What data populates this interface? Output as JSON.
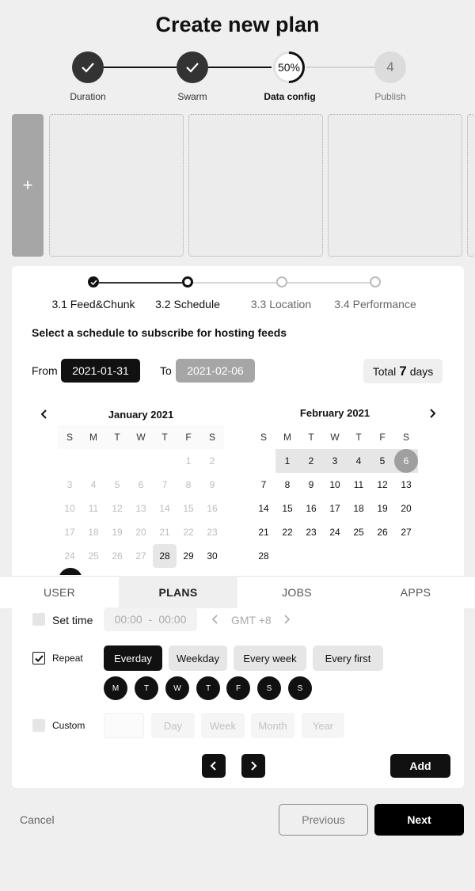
{
  "page": {
    "title": "Create new plan"
  },
  "main_steps": [
    {
      "label": "Duration",
      "state": "done"
    },
    {
      "label": "Swarm",
      "state": "done"
    },
    {
      "label": "Data config",
      "state": "in-progress",
      "progress_text": "50%",
      "progress": 0.5
    },
    {
      "label": "Publish",
      "state": "pending",
      "number": "4"
    }
  ],
  "media_strip": {
    "add_label": "+"
  },
  "sub_steps": [
    {
      "label": "3.1 Feed&Chunk",
      "state": "done"
    },
    {
      "label": "3.2 Schedule",
      "state": "current"
    },
    {
      "label": "3.3 Location",
      "state": "todo"
    },
    {
      "label": "3.4 Performance",
      "state": "todo"
    }
  ],
  "schedule": {
    "title": "Select a schedule to subscribe for hosting feeds",
    "from_label": "From",
    "from_value": "2021-01-31",
    "to_label": "To",
    "to_value": "2021-02-06",
    "total_label": "Total",
    "total_value": "7",
    "total_unit": "days"
  },
  "calendar": {
    "weekdays": [
      "S",
      "M",
      "T",
      "W",
      "T",
      "F",
      "S"
    ],
    "january": {
      "title": "January 2021",
      "rows": [
        [
          "",
          "",
          "",
          "",
          "",
          "1",
          "2"
        ],
        [
          "3",
          "4",
          "5",
          "6",
          "7",
          "8",
          "9"
        ],
        [
          "10",
          "11",
          "12",
          "13",
          "14",
          "15",
          "16"
        ],
        [
          "17",
          "18",
          "19",
          "20",
          "21",
          "22",
          "23"
        ],
        [
          "24",
          "25",
          "26",
          "27",
          "28",
          "29",
          "30"
        ]
      ]
    },
    "february": {
      "title": "February 2021",
      "rows": [
        [
          "",
          "1",
          "2",
          "3",
          "4",
          "5",
          "6"
        ],
        [
          "7",
          "8",
          "9",
          "10",
          "11",
          "12",
          "13"
        ],
        [
          "14",
          "15",
          "16",
          "17",
          "18",
          "19",
          "20"
        ],
        [
          "21",
          "22",
          "23",
          "24",
          "25",
          "26",
          "27"
        ],
        [
          "28",
          "",
          "",
          "",
          "",
          "",
          ""
        ]
      ]
    }
  },
  "tabs": [
    {
      "label": "USER",
      "active": false
    },
    {
      "label": "PLANS",
      "active": true
    },
    {
      "label": "JOBS",
      "active": false
    },
    {
      "label": "APPS",
      "active": false
    }
  ],
  "options": {
    "set_time": {
      "label": "Set time",
      "start": "00:00",
      "separator": "-",
      "end": "00:00",
      "timezone": "GMT +8",
      "checked": false
    },
    "repeat": {
      "label": "Repeat",
      "checked": true,
      "choices": [
        "Everday",
        "Weekday",
        "Every week",
        "Every first"
      ],
      "selected": "Everday",
      "days": [
        "M",
        "T",
        "W",
        "T",
        "F",
        "S",
        "S"
      ]
    },
    "custom": {
      "label": "Custom",
      "checked": false,
      "units": [
        "Day",
        "Week",
        "Month",
        "Year"
      ]
    },
    "add_label": "Add"
  },
  "footer": {
    "cancel_label": "Cancel",
    "previous_label": "Previous",
    "next_label": "Next"
  },
  "colors": {
    "background": "#efefef",
    "primary": "#111111",
    "muted": "#a6a6a6",
    "card": "#ffffff"
  },
  "icons": {
    "check": "check-icon",
    "chevron_left": "chevron-left-icon",
    "chevron_right": "chevron-right-icon",
    "plus": "plus-icon"
  }
}
